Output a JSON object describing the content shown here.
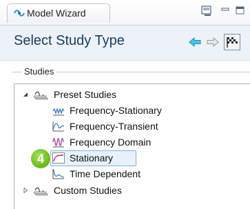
{
  "window": {
    "title": "Model Wizard",
    "title_icon": "comsol-wizard-icon"
  },
  "toolbar": {
    "buttons": [
      {
        "name": "screen-icon"
      },
      {
        "name": "minimize-icon"
      },
      {
        "name": "maximize-icon"
      }
    ]
  },
  "header": {
    "title": "Select Study Type",
    "nav": [
      {
        "name": "back-arrow-icon"
      },
      {
        "name": "forward-arrow-icon"
      },
      {
        "name": "finish-flag-icon"
      }
    ]
  },
  "studies": {
    "section_label": "Studies",
    "groups": [
      {
        "label": "Preset Studies",
        "expanded": true,
        "items": [
          {
            "label": "Frequency-Stationary",
            "icon": "frequency-stationary-icon"
          },
          {
            "label": "Frequency-Transient",
            "icon": "frequency-transient-icon"
          },
          {
            "label": "Frequency Domain",
            "icon": "frequency-domain-icon"
          },
          {
            "label": "Stationary",
            "icon": "stationary-icon",
            "selected": true
          },
          {
            "label": "Time Dependent",
            "icon": "time-dependent-icon"
          }
        ]
      },
      {
        "label": "Custom Studies",
        "expanded": false,
        "items": []
      }
    ]
  },
  "step_badge": {
    "number": "4",
    "color": "#6aba1f"
  },
  "colors": {
    "accent": "#1c3d63",
    "selection_bg": "#e9f1fc",
    "selection_border": "#7eb4ea"
  }
}
